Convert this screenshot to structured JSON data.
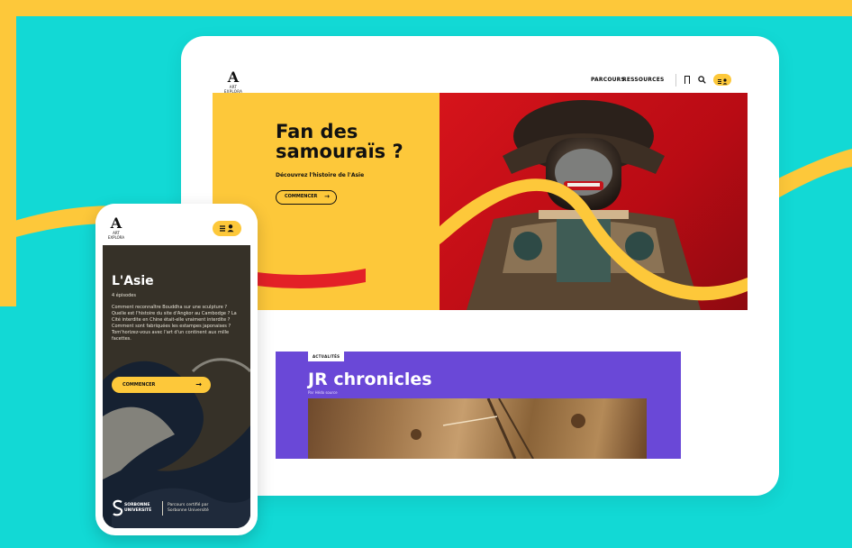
{
  "colors": {
    "background": "#12d9d5",
    "accent_yellow": "#fdc83a",
    "hero_red": "#d6141b",
    "news_purple": "#6a48d7"
  },
  "desktop": {
    "logo_mark": "A",
    "logo_word": "ART EXPLORA",
    "nav": {
      "parcours": "PARCOURS",
      "ressources": "RESSOURCES"
    },
    "icons": [
      "bookmark-icon",
      "search-icon",
      "menu-icon",
      "user-icon"
    ],
    "hero": {
      "title_line1": "Fan des",
      "title_line2": "samouraïs ?",
      "subtitle": "Découvrez l'histoire de l'Asie",
      "button": "COMMENCER",
      "button_arrow": "→"
    },
    "news": {
      "tag": "ACTUALITÉS",
      "title": "JR chronicles",
      "subtitle": "Par Hédo source"
    }
  },
  "phone": {
    "logo_mark": "A",
    "logo_word": "ART EXPLORA",
    "icons": [
      "menu-icon",
      "user-icon"
    ],
    "title": "L'Asie",
    "episodes": "4 épisodes",
    "description": "Comment reconnaître Bouddha sur une sculpture ? Quelle est l'histoire du site d'Angkor au Cambodge ? La Cité interdite en Chine était-elle vraiment interdite ? Comment sont fabriquées les estampes japonaises ? Tom'horizez-vous avec l'art d'un continent aux mille facettes.",
    "button": "COMMENCER",
    "button_arrow": "→",
    "partner_name_line1": "SORBONNE",
    "partner_name_line2": "UNIVERSITÉ",
    "partner_note_line1": "Parcours certifié par",
    "partner_note_line2": "Sorbonne Université"
  }
}
